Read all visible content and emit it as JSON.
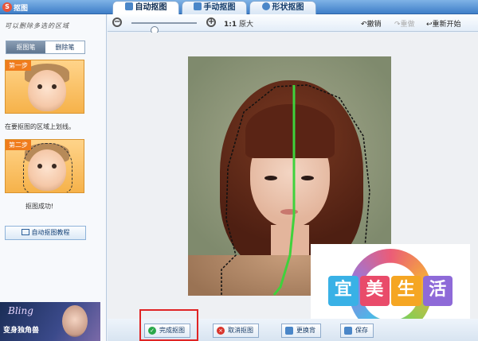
{
  "app": {
    "title": "抠图",
    "logo_letter": "S"
  },
  "tabs": [
    {
      "label": "自动抠图",
      "active": true,
      "icon": "brush-icon"
    },
    {
      "label": "手动抠图",
      "active": false,
      "icon": "pen-icon"
    },
    {
      "label": "形状抠图",
      "active": false,
      "icon": "shape-icon"
    }
  ],
  "sidebar": {
    "hint": "可以删除多选的区域",
    "brush_tabs": [
      {
        "label": "抠图笔",
        "active": true
      },
      {
        "label": "删除笔",
        "active": false
      }
    ],
    "steps": [
      {
        "badge": "第一步",
        "desc": "在要抠图的区域上划线。"
      },
      {
        "badge": "第二步",
        "desc": "抠图成功!"
      }
    ],
    "tutorial_label": "自动抠图教程"
  },
  "ad": {
    "brand": "Bling",
    "text": "变身独角兽"
  },
  "toolbar": {
    "zoom_ratio": "1:1",
    "zoom_label": "原大",
    "zoom_level": 0.35,
    "undo": "撤销",
    "redo": "重做",
    "reset": "重新开始"
  },
  "overlay": {
    "chars": [
      "宜",
      "美",
      "生",
      "活"
    ],
    "colors": [
      "#39b1e6",
      "#e94b6a",
      "#f5a623",
      "#8e6ad8"
    ]
  },
  "bottom": {
    "done": "完成抠图",
    "cancel": "取消抠图",
    "change_bg": "更换背",
    "save": "保存"
  },
  "colors": {
    "accent": "#3f7ec8",
    "highlight": "#e02424",
    "done_icon": "#2aa84a",
    "cancel_icon": "#d9342b"
  }
}
